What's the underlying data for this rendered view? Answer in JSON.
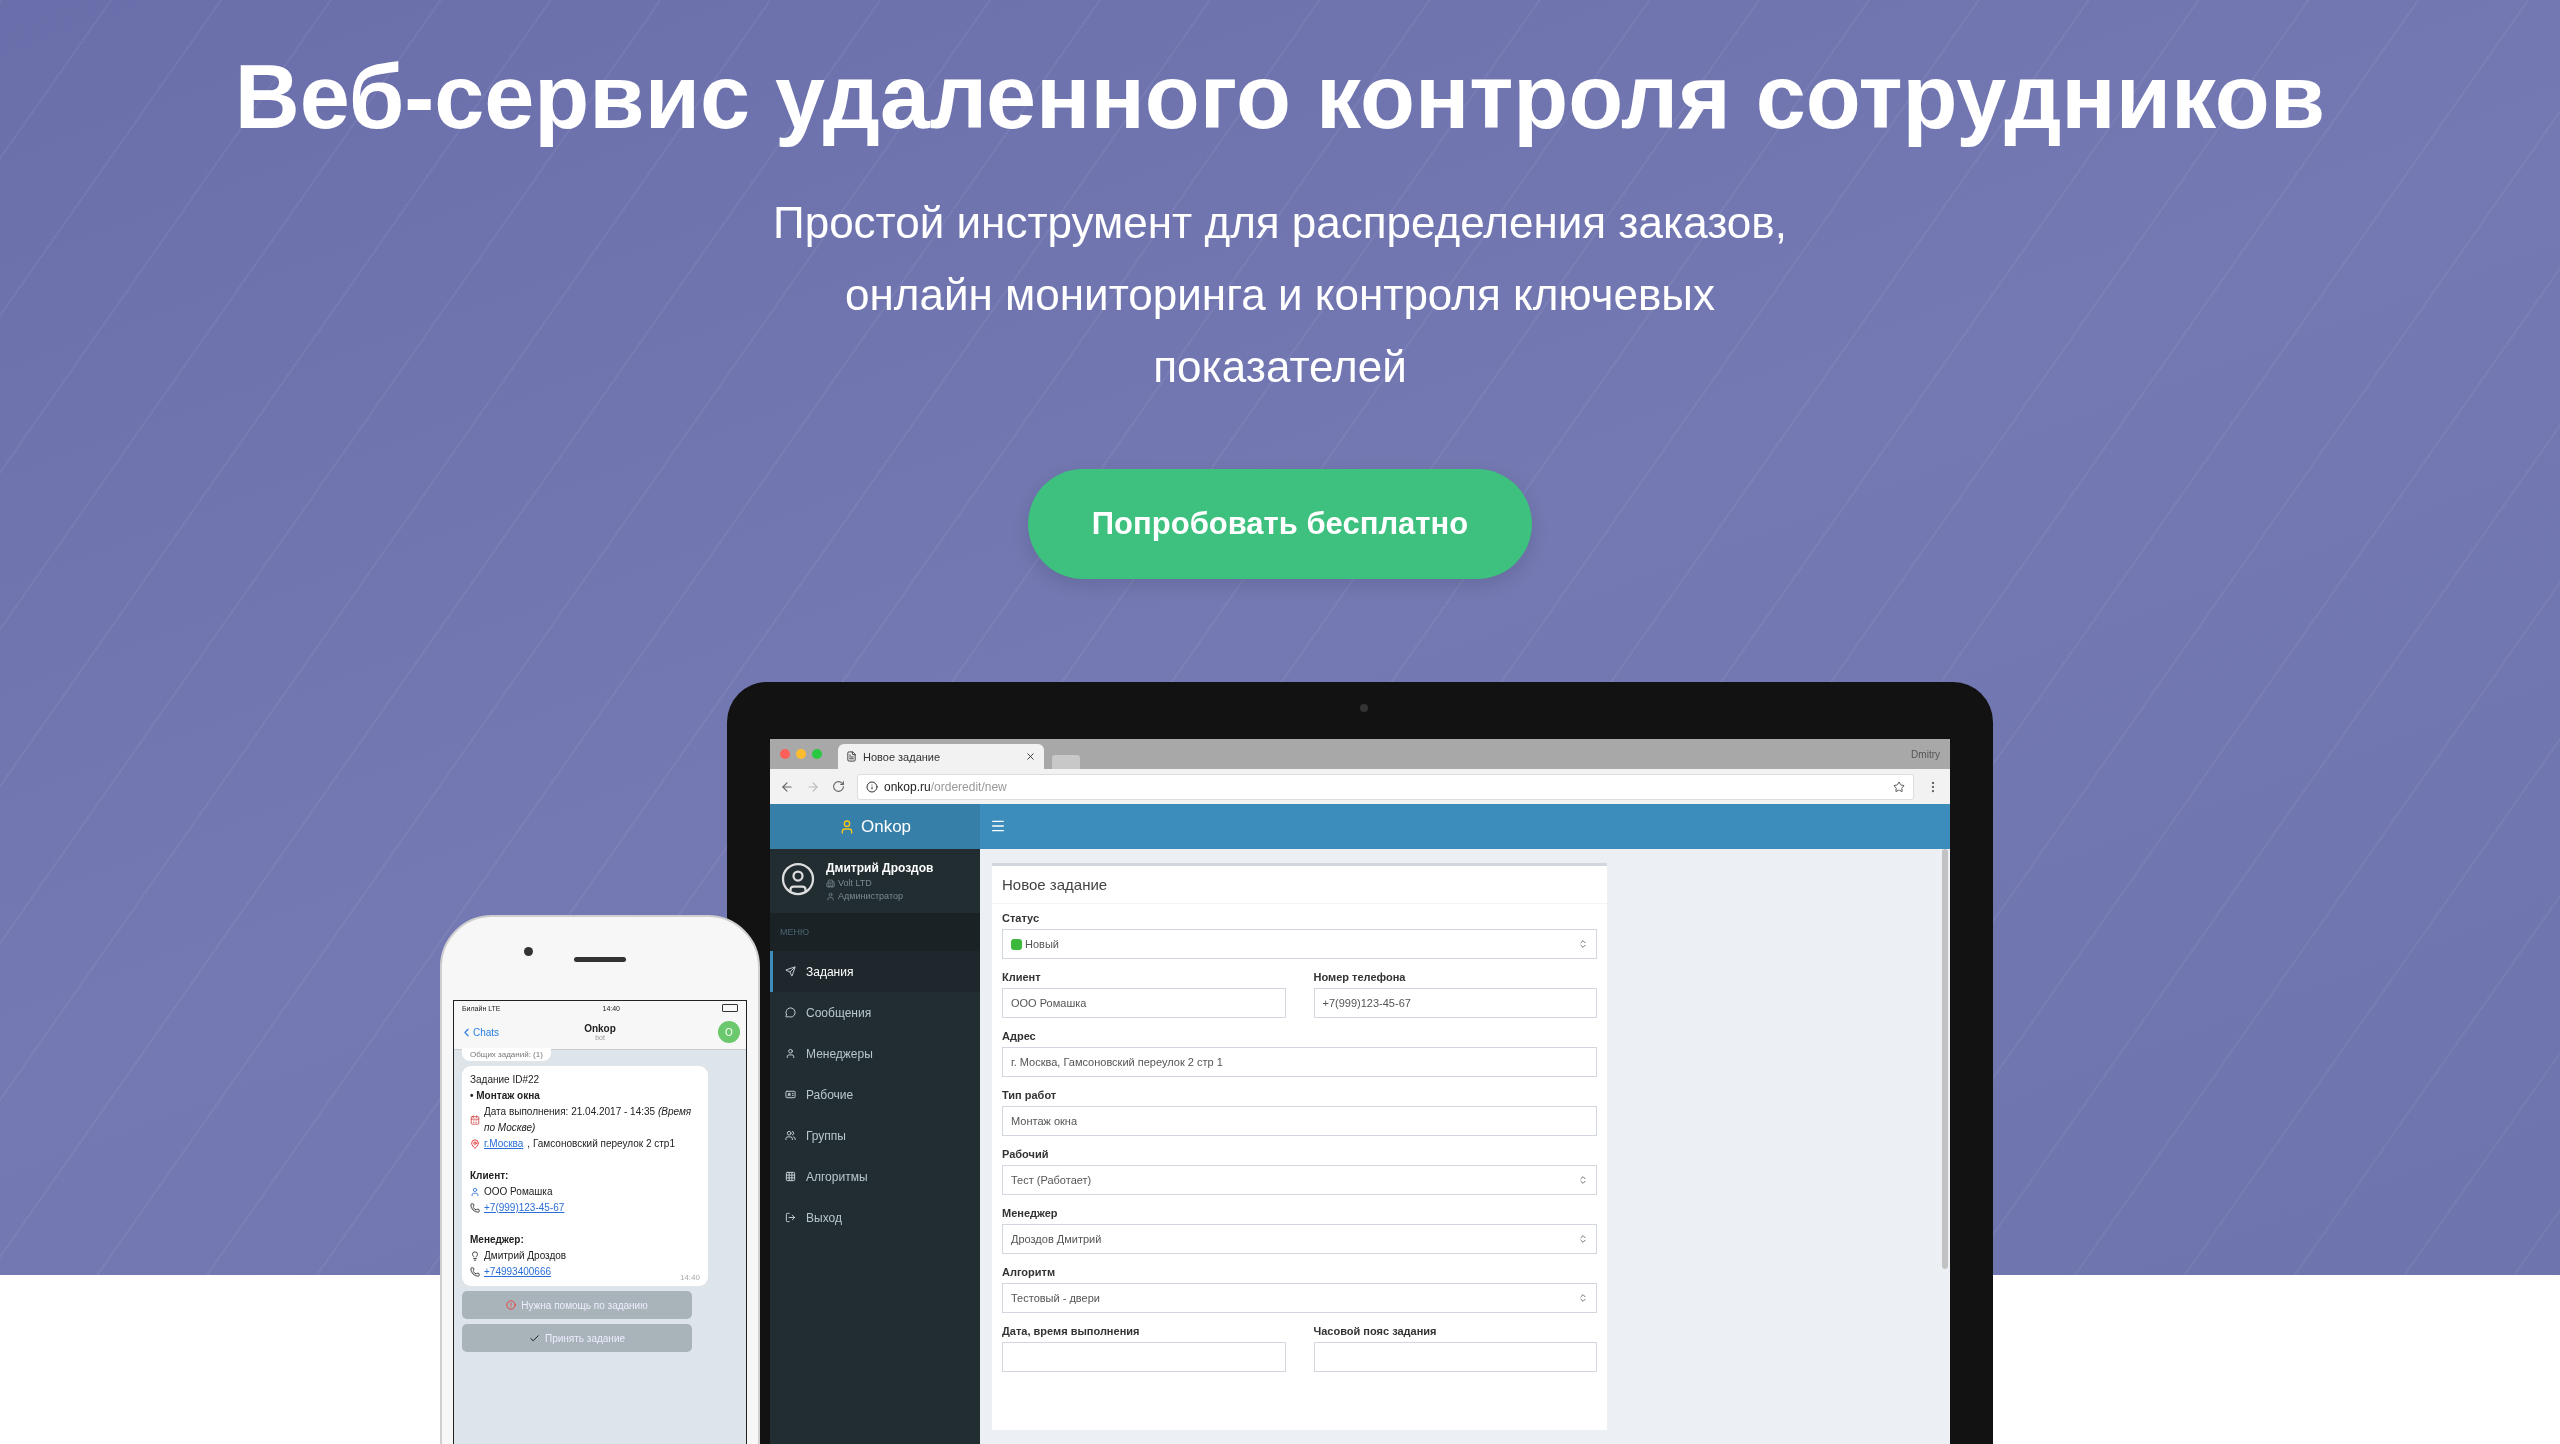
{
  "hero": {
    "title": "Веб-сервис удаленного контроля сотрудников",
    "subtitle": "Простой инструмент для распределения заказов, онлайн мониторинга и контроля ключевых показателей",
    "cta": "Попробовать бесплатно"
  },
  "laptop": {
    "browser": {
      "tab_title": "Новое задание",
      "profile": "Dmitry",
      "url_host": "onkop.ru",
      "url_path": "/orderedit/new"
    },
    "app": {
      "logo": "Onkop",
      "user": {
        "name": "Дмитрий Дроздов",
        "company": "Volt LTD",
        "role": "Администратор"
      },
      "menu_heading": "МЕНЮ",
      "menu": [
        {
          "label": "Задания",
          "selected": true
        },
        {
          "label": "Сообщения",
          "selected": false
        },
        {
          "label": "Менеджеры",
          "selected": false
        },
        {
          "label": "Рабочие",
          "selected": false
        },
        {
          "label": "Группы",
          "selected": false
        },
        {
          "label": "Алгоритмы",
          "selected": false
        },
        {
          "label": "Выход",
          "selected": false
        }
      ],
      "form": {
        "title": "Новое задание",
        "rows": [
          [
            {
              "label": "Статус",
              "value": "Новый",
              "kind": "select",
              "color": "#3cb93c"
            }
          ],
          [
            {
              "label": "Клиент",
              "value": "ООО Ромашка",
              "kind": "input"
            },
            {
              "label": "Номер телефона",
              "value": "+7(999)123-45-67",
              "kind": "input"
            }
          ],
          [
            {
              "label": "Адрес",
              "value": "г. Москва, Гамсоновский переулок 2 стр 1",
              "kind": "input"
            }
          ],
          [
            {
              "label": "Тип работ",
              "value": "Монтаж окна",
              "kind": "input"
            }
          ],
          [
            {
              "label": "Рабочий",
              "value": "Тест (Работает)",
              "kind": "select"
            }
          ],
          [
            {
              "label": "Менеджер",
              "value": "Дроздов Дмитрий",
              "kind": "select"
            }
          ],
          [
            {
              "label": "Алгоритм",
              "value": "Тестовый - двери",
              "kind": "select"
            }
          ],
          [
            {
              "label": "Дата, время выполнения",
              "kind": "input"
            },
            {
              "label": "Часовой пояс задания",
              "kind": "input"
            }
          ]
        ]
      }
    }
  },
  "phone": {
    "status": {
      "carrier": "Билайн LTE",
      "time": "14:40"
    },
    "chat": {
      "back": "Chats",
      "title": "Onkop",
      "subtitle": "bot",
      "avatar": "O"
    },
    "previous_message": "Общих заданий: (1)",
    "message": {
      "time": "14:40",
      "lines": [
        {
          "kind": "plain",
          "text": "Задание ID#22"
        },
        {
          "kind": "heading",
          "text": "• Монтаж окна"
        },
        {
          "kind": "date",
          "text": "Дата выполнения: 21.04.2017 - 14:35 *(Время по Москве)*"
        },
        {
          "kind": "address",
          "link": "г.Москва",
          "text": ", Гамсоновский переулок 2 стр1"
        },
        {
          "kind": "gap"
        },
        {
          "kind": "heading",
          "text": "Клиент:"
        },
        {
          "kind": "client",
          "text": "ООО Ромашка"
        },
        {
          "kind": "phone",
          "link": "+7(999)123-45-67"
        },
        {
          "kind": "gap"
        },
        {
          "kind": "heading",
          "text": "Менеджер:"
        },
        {
          "kind": "manager",
          "text": "Дмитрий Дроздов"
        },
        {
          "kind": "phone",
          "link": "+74993400666"
        }
      ]
    },
    "buttons": [
      "Нужна помощь по заданию",
      "Принять задание"
    ]
  }
}
